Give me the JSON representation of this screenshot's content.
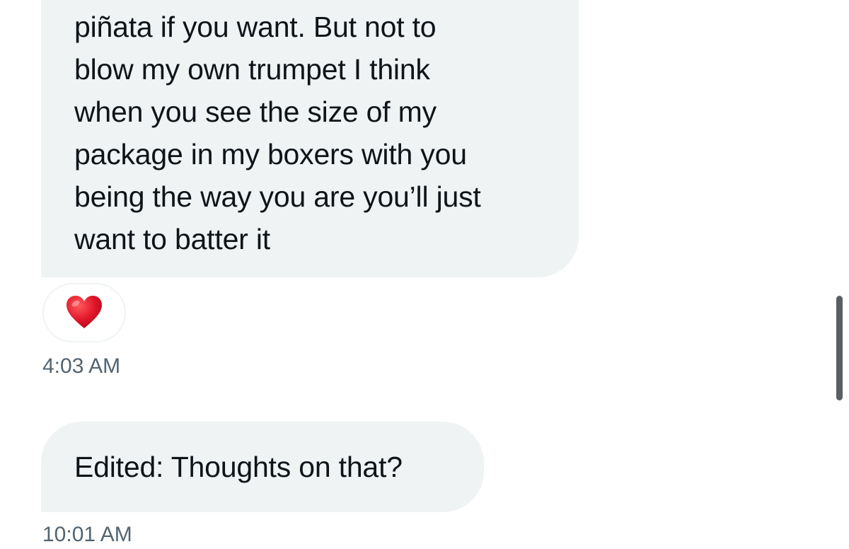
{
  "conversation": {
    "message_1": {
      "lines": [
        "piñata if you want. But not to",
        "blow my own trumpet I think",
        "when you see the size of my",
        "package in my boxers with you",
        "being the way you are you’ll just",
        "want to batter it"
      ],
      "reaction_icon": "red-heart",
      "timestamp": "4:03 AM"
    },
    "message_2": {
      "text": "Edited: Thoughts on that?",
      "timestamp": "10:01 AM"
    }
  },
  "colors": {
    "bubble_background": "#eff3f4",
    "message_text": "#0f1419",
    "timestamp_text": "#536471",
    "heart": "#e0162b",
    "scrollbar": "#5b5f63"
  }
}
